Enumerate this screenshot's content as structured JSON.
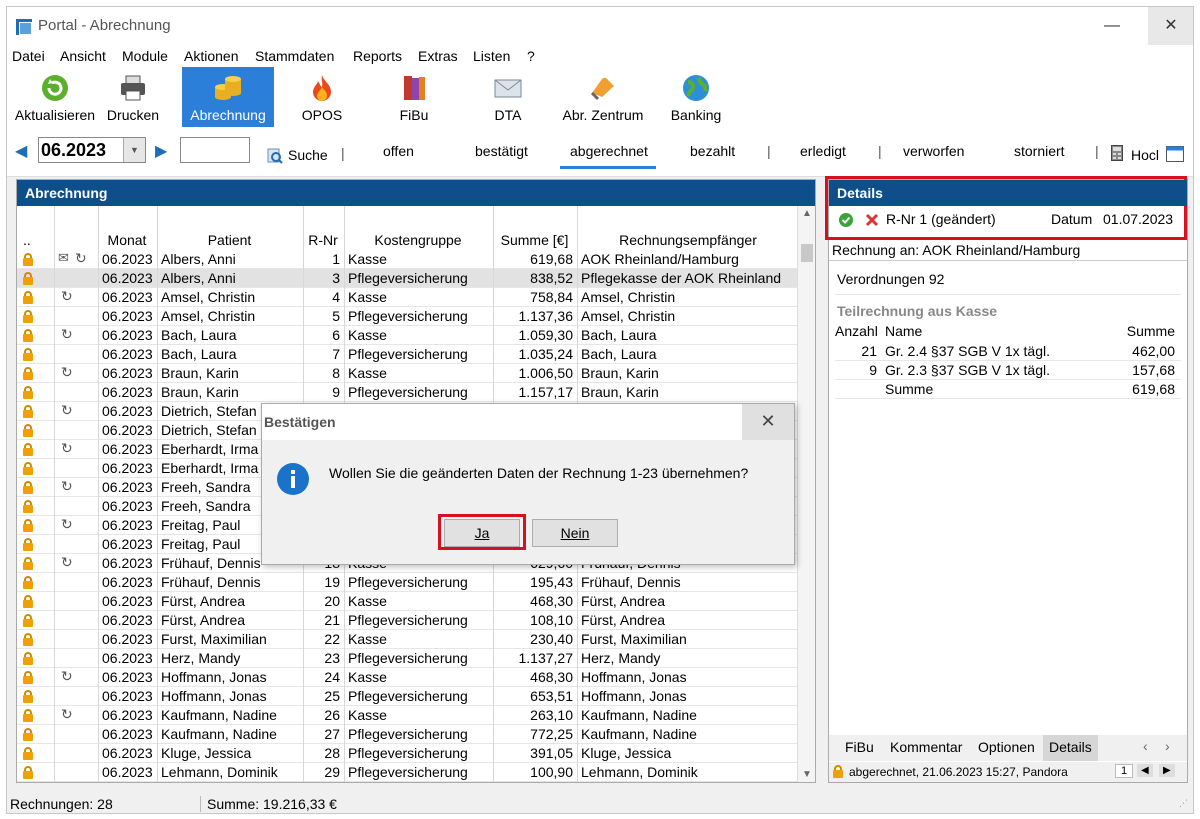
{
  "window": {
    "title": "Portal - Abrechnung",
    "minimize": "—",
    "maximize": "☐",
    "close": "✕"
  },
  "menu": [
    "Datei",
    "Ansicht",
    "Module",
    "Aktionen",
    "Stammdaten",
    "Reports",
    "Extras",
    "Listen",
    "?"
  ],
  "toolbar": [
    {
      "label": "Aktualisieren",
      "icon": "refresh-icon"
    },
    {
      "label": "Drucken",
      "icon": "printer-icon"
    },
    {
      "label": "Abrechnung",
      "icon": "coins-icon"
    },
    {
      "label": "OPOS",
      "icon": "flame-icon"
    },
    {
      "label": "FiBu",
      "icon": "books-icon"
    },
    {
      "label": "DTA",
      "icon": "envelope-icon"
    },
    {
      "label": "Abr. Zentrum",
      "icon": "hand-icon"
    },
    {
      "label": "Banking",
      "icon": "globe-icon"
    }
  ],
  "filter": {
    "month": "06.2023",
    "search_label": "Suche",
    "statuses": [
      "offen",
      "bestätigt",
      "abgerechnet",
      "bezahlt",
      "erledigt",
      "verworfen",
      "storniert"
    ],
    "active_status": "abgerechnet",
    "extra": "Hocl"
  },
  "left_panel": {
    "title": "Abrechnung",
    "columns": [
      "..",
      "",
      "Monat",
      "Patient",
      "R-Nr",
      "Kostengruppe",
      "Summe [€]",
      "Rechnungsempfänger"
    ],
    "rows": [
      [
        "06.2023",
        "Albers, Anni",
        "1",
        "Kasse",
        "619,68",
        "AOK Rheinland/Hamburg"
      ],
      [
        "06.2023",
        "Albers, Anni",
        "3",
        "Pflegeversicherung",
        "838,52",
        "Pflegekasse der AOK Rheinland"
      ],
      [
        "06.2023",
        "Amsel, Christin",
        "4",
        "Kasse",
        "758,84",
        "Amsel, Christin"
      ],
      [
        "06.2023",
        "Amsel, Christin",
        "5",
        "Pflegeversicherung",
        "1.137,36",
        "Amsel, Christin"
      ],
      [
        "06.2023",
        "Bach, Laura",
        "6",
        "Kasse",
        "1.059,30",
        "Bach, Laura"
      ],
      [
        "06.2023",
        "Bach, Laura",
        "7",
        "Pflegeversicherung",
        "1.035,24",
        "Bach, Laura"
      ],
      [
        "06.2023",
        "Braun, Karin",
        "8",
        "Kasse",
        "1.006,50",
        "Braun, Karin"
      ],
      [
        "06.2023",
        "Braun, Karin",
        "9",
        "Pflegeversicherung",
        "1.157,17",
        "Braun, Karin"
      ],
      [
        "06.2023",
        "Dietrich, Stefan",
        "",
        "",
        "",
        ""
      ],
      [
        "06.2023",
        "Dietrich, Stefan",
        "",
        "",
        "",
        ""
      ],
      [
        "06.2023",
        "Eberhardt, Irma",
        "",
        "",
        "",
        ""
      ],
      [
        "06.2023",
        "Eberhardt, Irma",
        "",
        "",
        "",
        ""
      ],
      [
        "06.2023",
        "Freeh, Sandra",
        "",
        "",
        "",
        ""
      ],
      [
        "06.2023",
        "Freeh, Sandra",
        "",
        "",
        "",
        ""
      ],
      [
        "06.2023",
        "Freitag, Paul",
        "",
        "",
        "",
        ""
      ],
      [
        "06.2023",
        "Freitag, Paul",
        "",
        "",
        "",
        ""
      ],
      [
        "06.2023",
        "Frühauf, Dennis",
        "18",
        "Kasse",
        "629,60",
        "Frühauf, Dennis"
      ],
      [
        "06.2023",
        "Frühauf, Dennis",
        "19",
        "Pflegeversicherung",
        "195,43",
        "Frühauf, Dennis"
      ],
      [
        "06.2023",
        "Fürst, Andrea",
        "20",
        "Kasse",
        "468,30",
        "Fürst, Andrea"
      ],
      [
        "06.2023",
        "Fürst, Andrea",
        "21",
        "Pflegeversicherung",
        "108,10",
        "Fürst, Andrea"
      ],
      [
        "06.2023",
        "Furst, Maximilian",
        "22",
        "Kasse",
        "230,40",
        "Furst, Maximilian"
      ],
      [
        "06.2023",
        "Herz, Mandy",
        "23",
        "Pflegeversicherung",
        "1.137,27",
        "Herz, Mandy"
      ],
      [
        "06.2023",
        "Hoffmann, Jonas",
        "24",
        "Kasse",
        "468,30",
        "Hoffmann, Jonas"
      ],
      [
        "06.2023",
        "Hoffmann, Jonas",
        "25",
        "Pflegeversicherung",
        "653,51",
        "Hoffmann, Jonas"
      ],
      [
        "06.2023",
        "Kaufmann, Nadine",
        "26",
        "Kasse",
        "263,10",
        "Kaufmann, Nadine"
      ],
      [
        "06.2023",
        "Kaufmann, Nadine",
        "27",
        "Pflegeversicherung",
        "772,25",
        "Kaufmann, Nadine"
      ],
      [
        "06.2023",
        "Kluge, Jessica",
        "28",
        "Pflegeversicherung",
        "391,05",
        "Kluge, Jessica"
      ],
      [
        "06.2023",
        "Lehmann, Dominik",
        "29",
        "Pflegeversicherung",
        "100,90",
        "Lehmann, Dominik"
      ]
    ],
    "row_icons": [
      "mail-refresh",
      "",
      "refresh",
      "",
      "refresh",
      "",
      "refresh",
      "",
      "refresh",
      "",
      "refresh",
      "",
      "refresh",
      "",
      "refresh",
      "",
      "refresh",
      "",
      "",
      "",
      "",
      "",
      "refresh",
      "",
      "refresh",
      "",
      "",
      ""
    ]
  },
  "right_panel": {
    "title": "Details",
    "rnr": "R-Nr 1 (geändert)",
    "date_label": "Datum",
    "date": "01.07.2023",
    "recipient": "Rechnung an: AOK Rheinland/Hamburg",
    "verordnungen": "Verordnungen 92",
    "sub_title": "Teilrechnung aus Kasse",
    "headers": {
      "count": "Anzahl",
      "name": "Name",
      "sum": "Summe"
    },
    "items": [
      {
        "count": "21",
        "name": "Gr. 2.4 §37 SGB V 1x tägl.",
        "sum": "462,00"
      },
      {
        "count": "9",
        "name": "Gr. 2.3 §37 SGB V 1x tägl.",
        "sum": "157,68"
      },
      {
        "count": "",
        "name": "Summe",
        "sum": "619,68"
      }
    ],
    "tabs": [
      "FiBu",
      "Kommentar",
      "Optionen",
      "Details"
    ],
    "active_tab": "Details",
    "status": "abgerechnet, 21.06.2023 15:27, Pandora",
    "page": "1"
  },
  "dialog": {
    "title": "Bestätigen",
    "message": "Wollen Sie die geänderten Daten der Rechnung 1-23 übernehmen?",
    "yes": "Ja",
    "no": "Nein"
  },
  "statusbar": {
    "count": "Rechnungen: 28",
    "sum": "Summe: 19.216,33 €"
  },
  "colors": {
    "accent": "#2c7fd8",
    "header": "#0e4f8b",
    "highlight": "#d7101f",
    "lock": "#f0a000"
  }
}
